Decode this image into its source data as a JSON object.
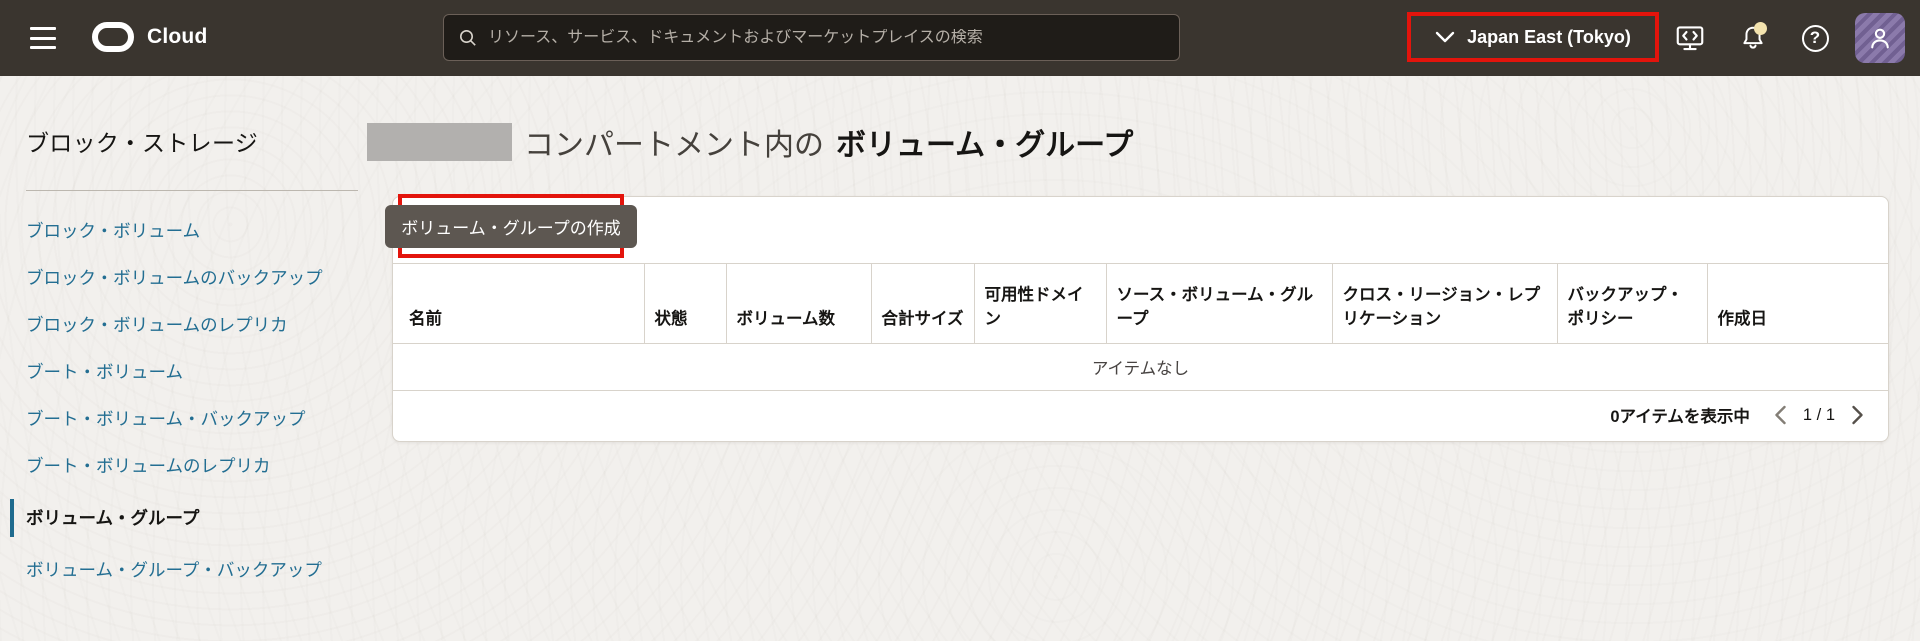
{
  "colors": {
    "topbar_bg": "#3a352f",
    "annotation_red": "#e3140c",
    "link_teal": "#236e92",
    "button_bg": "#5d5751",
    "avatar_purple": "#8b7aab",
    "card_bg": "#ffffff",
    "page_bg": "#f2f0ed"
  },
  "topbar": {
    "brand": "Cloud",
    "search_placeholder": "リソース、サービス、ドキュメントおよびマーケットプレイスの検索",
    "region": "Japan East (Tokyo)",
    "icons": [
      "hamburger-menu",
      "oracle-logo",
      "search",
      "chevron-down",
      "cloud-shell",
      "notifications",
      "help",
      "user-avatar"
    ]
  },
  "sidebar": {
    "title": "ブロック・ストレージ",
    "items": [
      {
        "label": "ブロック・ボリューム",
        "selected": false
      },
      {
        "label": "ブロック・ボリュームのバックアップ",
        "selected": false
      },
      {
        "label": "ブロック・ボリュームのレプリカ",
        "selected": false
      },
      {
        "label": "ブート・ボリューム",
        "selected": false
      },
      {
        "label": "ブート・ボリューム・バックアップ",
        "selected": false
      },
      {
        "label": "ブート・ボリュームのレプリカ",
        "selected": false
      },
      {
        "label": "ボリューム・グループ",
        "selected": true
      },
      {
        "label": "ボリューム・グループ・バックアップ",
        "selected": false
      }
    ]
  },
  "main": {
    "title_prefix": "コンパートメント内の",
    "title_emphasis": "ボリューム・グループ",
    "create_button_label": "ボリューム・グループの作成",
    "table": {
      "columns": [
        "名前",
        "状態",
        "ボリューム数",
        "合計サイズ",
        "可用性ドメイン",
        "ソース・ボリューム・グループ",
        "クロス・リージョン・レプリケーション",
        "バックアップ・ポリシー",
        "作成日"
      ],
      "rows": [],
      "empty_message": "アイテムなし"
    },
    "pagination": {
      "summary": "0アイテムを表示中",
      "page_indicator": "1 / 1"
    }
  }
}
